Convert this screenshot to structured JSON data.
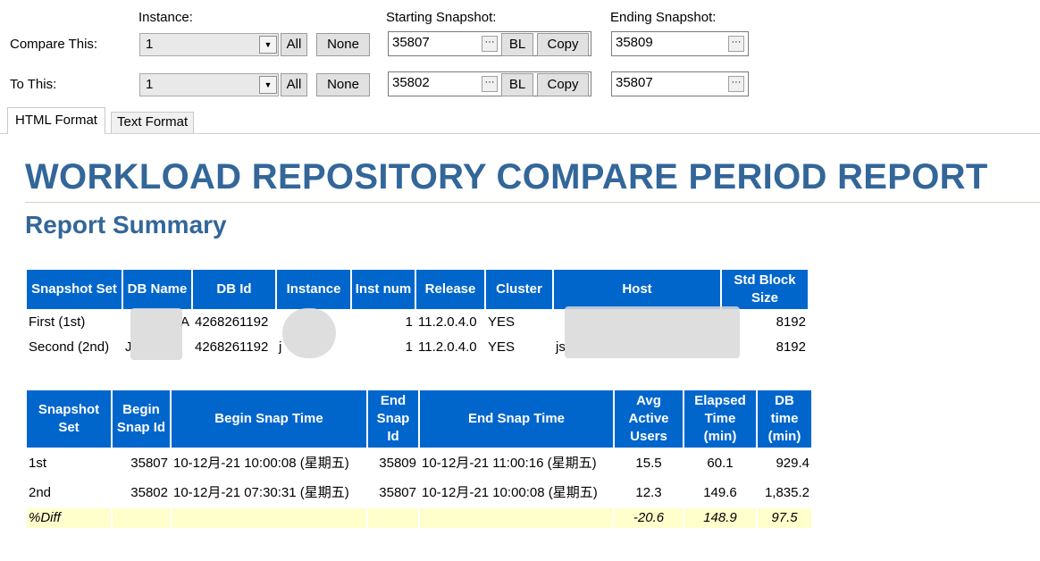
{
  "toolbar": {
    "instance_header": "Instance:",
    "start_header": "Starting Snapshot:",
    "end_header": "Ending Snapshot:",
    "compare_label": "Compare This:",
    "to_label": "To This:",
    "compare_instance": "1",
    "to_instance": "1",
    "all_label": "All",
    "none_label": "None",
    "bl_label": "BL",
    "copy_label": "Copy",
    "ellipsis": "···",
    "compare_start": "35807",
    "compare_end": "35809",
    "to_start": "35802",
    "to_end": "35807"
  },
  "tabs": [
    "HTML Format",
    "Text Format"
  ],
  "report": {
    "title": "WORKLOAD REPOSITORY COMPARE PERIOD REPORT",
    "summary_title": "Report Summary"
  },
  "table1": {
    "headers": [
      "Snapshot Set",
      "DB Name",
      "DB Id",
      "Instance",
      "Inst num",
      "Release",
      "Cluster",
      "Host",
      "Std Block Size"
    ],
    "rows": [
      [
        "First (1st)",
        "A",
        "4268261192",
        "",
        "1",
        "11.2.0.4.0",
        "YES",
        "",
        "8192"
      ],
      [
        "Second (2nd)",
        "J",
        "4268261192",
        "j",
        "1",
        "11.2.0.4.0",
        "YES",
        "js",
        "8192"
      ]
    ]
  },
  "table2": {
    "headers": [
      "Snapshot Set",
      "Begin Snap Id",
      "Begin Snap Time",
      "End Snap Id",
      "End Snap Time",
      "Avg Active Users",
      "Elapsed Time (min)",
      "DB time (min)"
    ],
    "rows": [
      [
        "1st",
        "35807",
        "10-12月-21 10:00:08 (星期五)",
        "35809",
        "10-12月-21 11:00:16 (星期五)",
        "15.5",
        "60.1",
        "929.4"
      ],
      [
        "2nd",
        "35802",
        "10-12月-21 07:30:31 (星期五)",
        "35807",
        "10-12月-21 10:00:08 (星期五)",
        "12.3",
        "149.6",
        "1,835.2"
      ]
    ],
    "diff_row": [
      "%Diff",
      "",
      "",
      "",
      "",
      "-20.6",
      "148.9",
      "97.5"
    ]
  }
}
